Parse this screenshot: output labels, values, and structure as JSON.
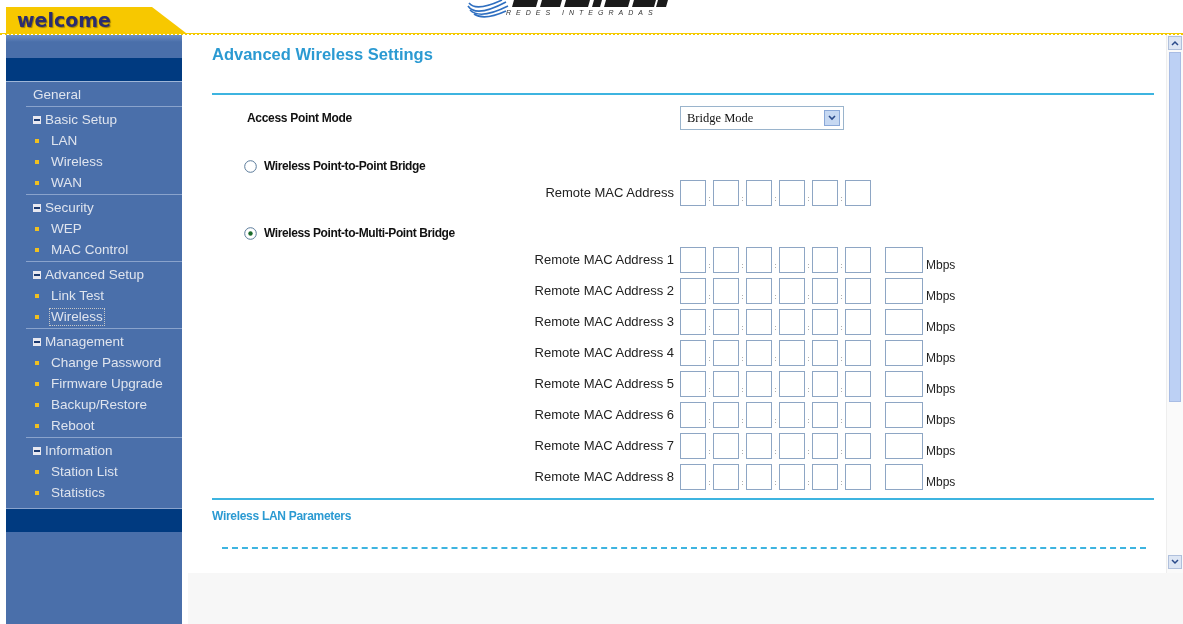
{
  "header": {
    "tab": "welcome",
    "logo_subtitle": "REDES INTEGRADAS"
  },
  "sidebar": {
    "sections": [
      {
        "title": "General",
        "kind": "link"
      },
      {
        "title": "Basic Setup",
        "kind": "group",
        "expanded": true,
        "items": [
          {
            "label": "LAN",
            "selected": false
          },
          {
            "label": "Wireless",
            "selected": false
          },
          {
            "label": "WAN",
            "selected": false
          }
        ]
      },
      {
        "title": "Security",
        "kind": "group",
        "expanded": true,
        "items": [
          {
            "label": "WEP",
            "selected": false
          },
          {
            "label": "MAC Control",
            "selected": false
          }
        ]
      },
      {
        "title": "Advanced Setup",
        "kind": "group",
        "expanded": true,
        "items": [
          {
            "label": "Link Test",
            "selected": false
          },
          {
            "label": "Wireless",
            "selected": true
          }
        ]
      },
      {
        "title": "Management",
        "kind": "group",
        "expanded": true,
        "items": [
          {
            "label": "Change Password",
            "selected": false
          },
          {
            "label": "Firmware Upgrade",
            "selected": false
          },
          {
            "label": "Backup/Restore",
            "selected": false
          },
          {
            "label": "Reboot",
            "selected": false
          }
        ]
      },
      {
        "title": "Information",
        "kind": "group",
        "expanded": true,
        "items": [
          {
            "label": "Station List",
            "selected": false
          },
          {
            "label": "Statistics",
            "selected": false
          }
        ]
      }
    ]
  },
  "page": {
    "title": "Advanced Wireless Settings",
    "access_point_mode": {
      "label": "Access Point Mode",
      "value": "Bridge Mode"
    },
    "separator": ":",
    "bridges": [
      {
        "label": "Wireless Point-to-Point Bridge",
        "selected": false,
        "rows": [
          {
            "label": "Remote MAC Address"
          }
        ]
      },
      {
        "label": "Wireless Point-to-Multi-Point Bridge",
        "selected": true,
        "rows": [
          {
            "label": "Remote MAC Address 1",
            "unit": "Mbps"
          },
          {
            "label": "Remote MAC Address 2",
            "unit": "Mbps"
          },
          {
            "label": "Remote MAC Address 3",
            "unit": "Mbps"
          },
          {
            "label": "Remote MAC Address 4",
            "unit": "Mbps"
          },
          {
            "label": "Remote MAC Address 5",
            "unit": "Mbps"
          },
          {
            "label": "Remote MAC Address 6",
            "unit": "Mbps"
          },
          {
            "label": "Remote MAC Address 7",
            "unit": "Mbps"
          },
          {
            "label": "Remote MAC Address 8",
            "unit": "Mbps"
          }
        ]
      }
    ],
    "section_title": "Wireless LAN Parameters"
  }
}
